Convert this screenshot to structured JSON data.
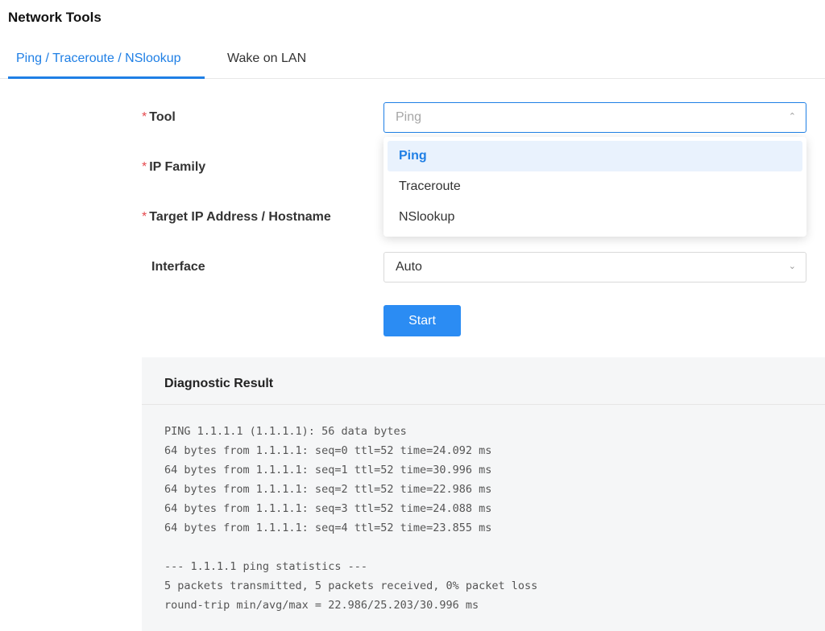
{
  "page_title": "Network Tools",
  "tabs": [
    {
      "label": "Ping / Traceroute / NSlookup",
      "active": true
    },
    {
      "label": "Wake on LAN",
      "active": false
    }
  ],
  "form": {
    "required_mark": "*",
    "tool": {
      "label": "Tool",
      "value": "Ping",
      "icon": "chevron-up-icon"
    },
    "ip_family": {
      "label": "IP Family"
    },
    "target": {
      "label": "Target IP Address / Hostname"
    },
    "interface": {
      "label": "Interface",
      "value": "Auto",
      "icon": "chevron-down-icon"
    }
  },
  "dropdown": {
    "options": [
      "Ping",
      "Traceroute",
      "NSlookup"
    ],
    "selected": "Ping"
  },
  "start_button": "Start",
  "result": {
    "title": "Diagnostic Result",
    "output": "PING 1.1.1.1 (1.1.1.1): 56 data bytes\n64 bytes from 1.1.1.1: seq=0 ttl=52 time=24.092 ms\n64 bytes from 1.1.1.1: seq=1 ttl=52 time=30.996 ms\n64 bytes from 1.1.1.1: seq=2 ttl=52 time=22.986 ms\n64 bytes from 1.1.1.1: seq=3 ttl=52 time=24.088 ms\n64 bytes from 1.1.1.1: seq=4 ttl=52 time=23.855 ms\n\n--- 1.1.1.1 ping statistics ---\n5 packets transmitted, 5 packets received, 0% packet loss\nround-trip min/avg/max = 22.986/25.203/30.996 ms"
  },
  "colors": {
    "accent": "#1f7fe5",
    "button": "#2b8cf3",
    "required": "#e5484d",
    "result_bg": "#f5f6f7"
  }
}
